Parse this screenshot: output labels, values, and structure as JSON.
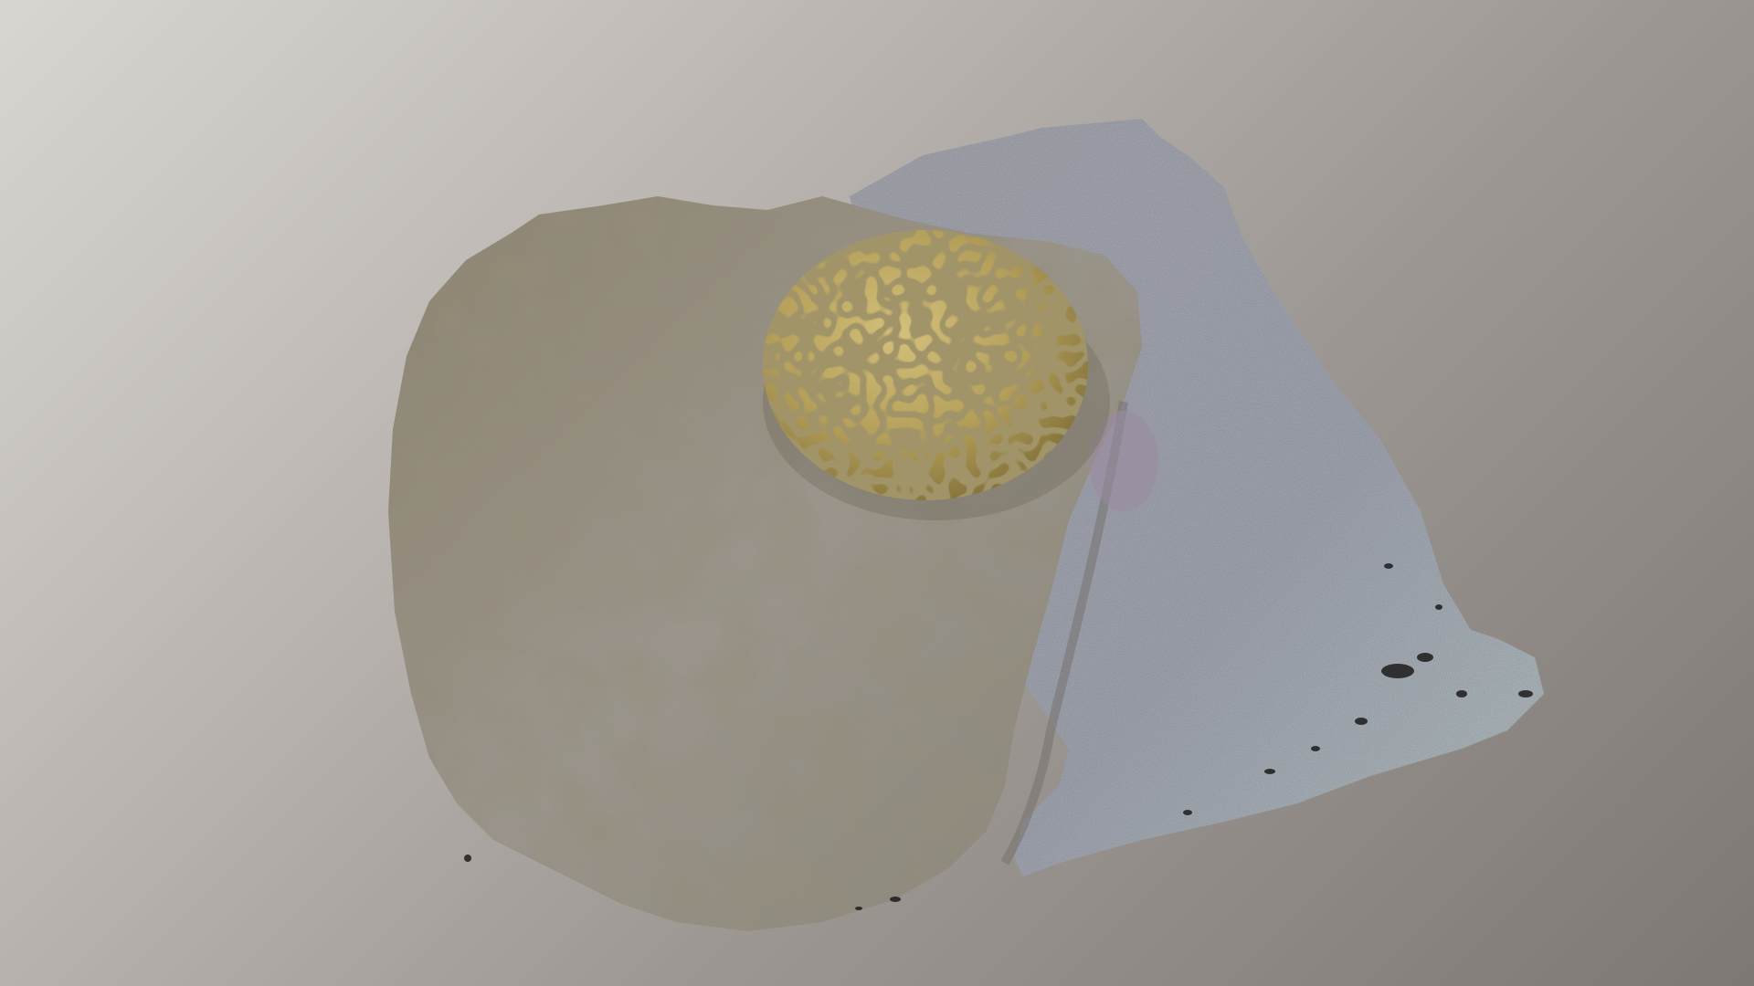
{
  "scene": {
    "subject": "coral-3d-model",
    "colors": {
      "background_light": "#dedbd7",
      "background_dark": "#7a7571",
      "rock_left": "#8f8a7a",
      "rock_right": "#9ea6b4",
      "coral_base": "#b8a25c",
      "coral_groove": "#5e4f24"
    }
  }
}
